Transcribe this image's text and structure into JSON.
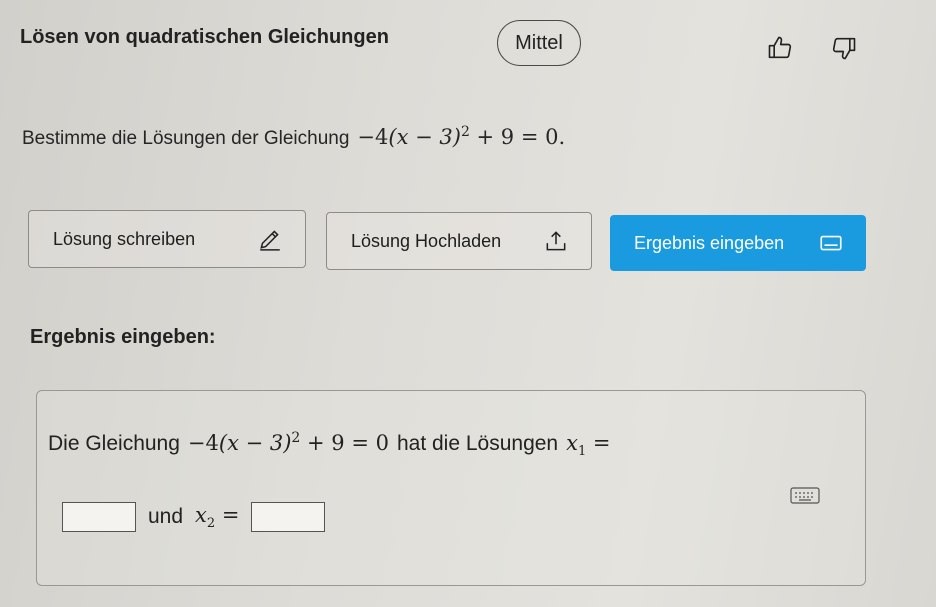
{
  "header": {
    "title": "Lösen von quadratischen Gleichungen",
    "difficulty": "Mittel"
  },
  "task": {
    "prompt": "Bestimme die Lösungen der Gleichung",
    "equation": {
      "coef": "−4",
      "inner": "(x − 3)",
      "exp": "2",
      "rest": " + 9 = 0."
    }
  },
  "actions": {
    "write_label": "Lösung schreiben",
    "upload_label": "Lösung Hochladen",
    "enter_label": "Ergebnis eingeben"
  },
  "result_section": {
    "title": "Ergebnis eingeben:",
    "text_before": "Die Gleichung",
    "equation": {
      "coef": "−4",
      "inner": "(x − 3)",
      "exp": "2",
      "rest": " + 9 = 0"
    },
    "text_after": "hat die Lösungen",
    "x1_var": "x",
    "x1_sub": "1",
    "x1_eq": "=",
    "and_label": "und",
    "x2_var": "x",
    "x2_sub": "2",
    "x2_eq": "=",
    "x1_value": "",
    "x2_value": ""
  },
  "colors": {
    "accent": "#1a9be0",
    "background": "#dedcd7"
  },
  "icons": [
    "thumbs-up-icon",
    "thumbs-down-icon",
    "pencil-icon",
    "upload-icon",
    "keyboard-icon"
  ]
}
